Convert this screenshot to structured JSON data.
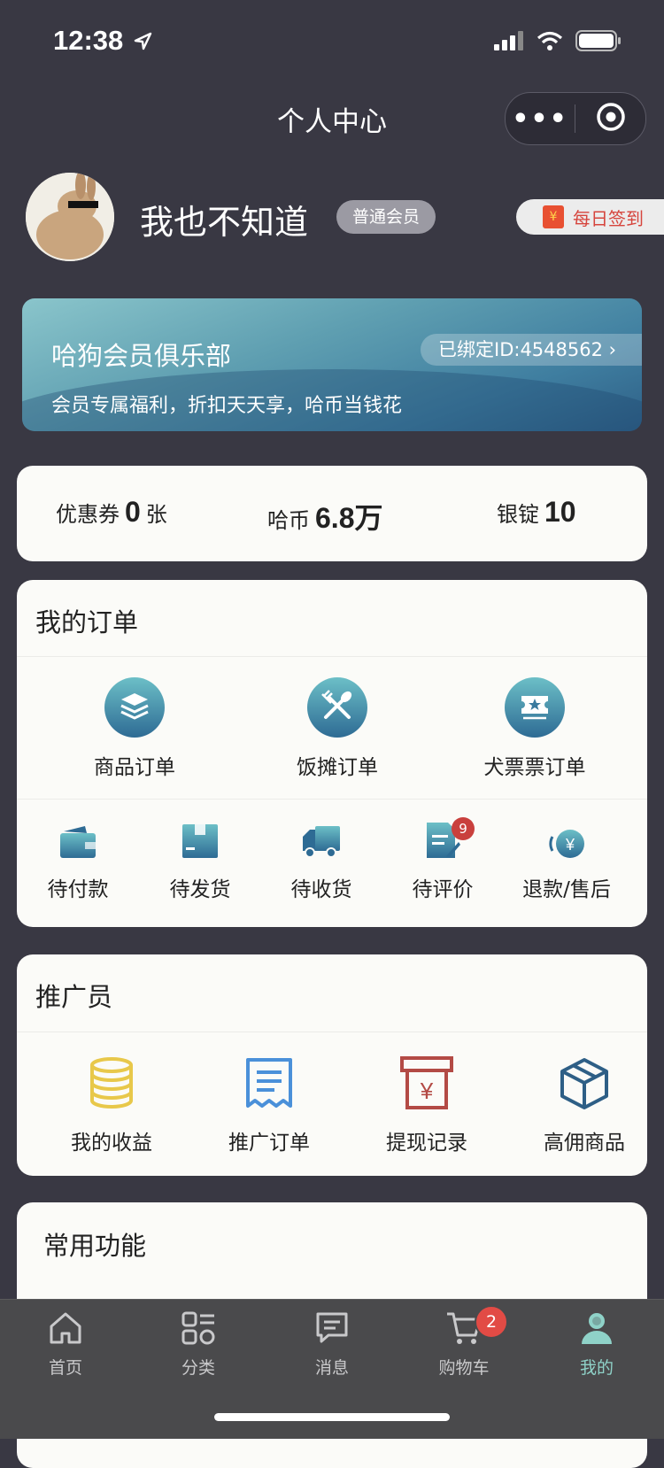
{
  "status_bar": {
    "time": "12:38"
  },
  "nav": {
    "title": "个人中心",
    "more_label": "•••"
  },
  "profile": {
    "username": "我也不知道",
    "member_level": "普通会员",
    "checkin_label": "每日签到"
  },
  "vip_banner": {
    "title": "哈狗会员俱乐部",
    "bound_id": "已绑定ID:4548562 ›",
    "subtitle": "会员专属福利，折扣天天享，哈币当钱花"
  },
  "assets": [
    {
      "label": "优惠券",
      "value": "0",
      "unit": "张"
    },
    {
      "label": "哈币",
      "value": "6.8万",
      "unit": ""
    },
    {
      "label": "银锭",
      "value": "10",
      "unit": ""
    }
  ],
  "orders": {
    "title": "我的订单",
    "types": [
      {
        "label": "商品订单",
        "icon": "layers-icon"
      },
      {
        "label": "饭摊订单",
        "icon": "utensils-icon"
      },
      {
        "label": "犬票票订单",
        "icon": "ticket-icon"
      }
    ],
    "statuses": [
      {
        "label": "待付款",
        "icon": "wallet-icon"
      },
      {
        "label": "待发货",
        "icon": "package-icon"
      },
      {
        "label": "待收货",
        "icon": "truck-icon"
      },
      {
        "label": "待评价",
        "icon": "review-icon",
        "badge": "9"
      },
      {
        "label": "退款/售后",
        "icon": "refund-icon"
      }
    ]
  },
  "promoter": {
    "title": "推广员",
    "items": [
      {
        "label": "我的收益",
        "icon": "coins-icon",
        "color": "#e8c84a"
      },
      {
        "label": "推广订单",
        "icon": "receipt-icon",
        "color": "#4a90d9"
      },
      {
        "label": "提现记录",
        "icon": "withdraw-icon",
        "color": "#b34a45"
      },
      {
        "label": "高佣商品",
        "icon": "box-icon",
        "color": "#2e5f86"
      }
    ]
  },
  "common": {
    "title": "常用功能"
  },
  "tabbar": {
    "items": [
      {
        "label": "首页",
        "icon": "home-icon"
      },
      {
        "label": "分类",
        "icon": "category-icon"
      },
      {
        "label": "消息",
        "icon": "message-icon"
      },
      {
        "label": "购物车",
        "icon": "cart-icon",
        "badge": "2"
      },
      {
        "label": "我的",
        "icon": "profile-icon",
        "active": true
      }
    ]
  }
}
